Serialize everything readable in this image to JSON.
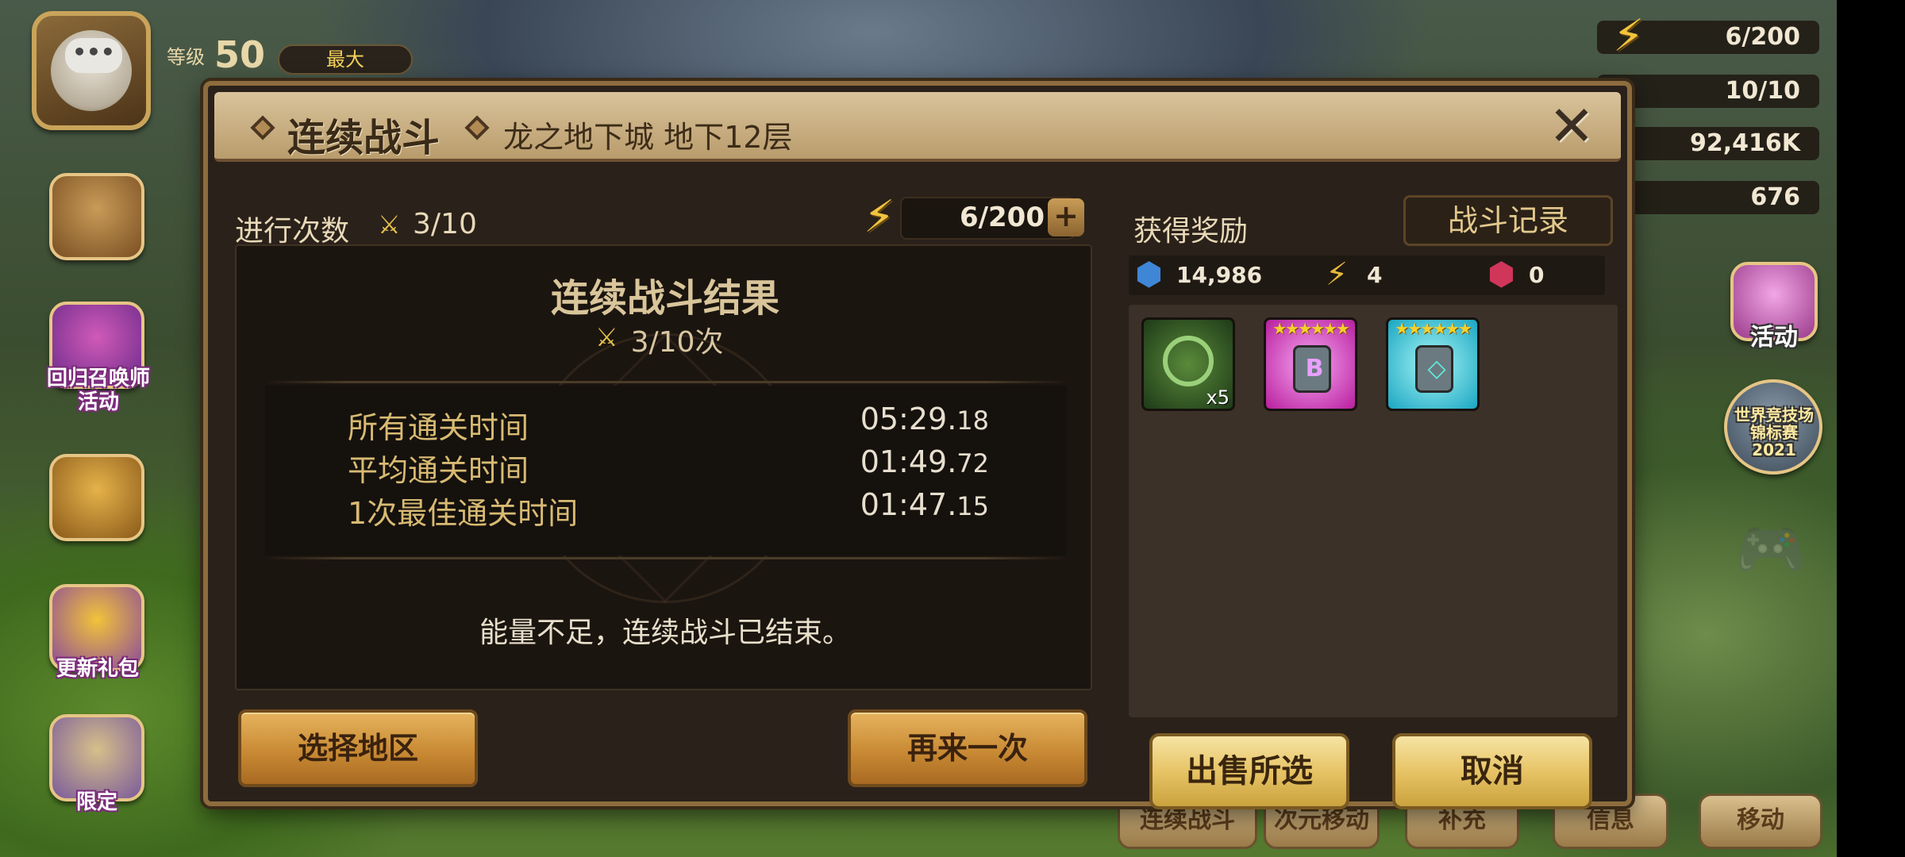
{
  "hud": {
    "chat_glyph": "•••",
    "level_label": "等级",
    "level_value": "50",
    "level_bar_text": "最大",
    "resources": [
      "6/200",
      "10/10",
      "92,416K",
      "676"
    ],
    "left_menu": [
      {
        "label": "",
        "icon": "tome-icon"
      },
      {
        "label": "回归召唤师\n活动",
        "icon": "gift-icon"
      },
      {
        "label": "",
        "icon": "treasure-chest-icon"
      },
      {
        "label": "更新礼包",
        "icon": "package-icon"
      },
      {
        "label": "限定",
        "icon": "limited-pack-icon"
      }
    ],
    "right_menu": [
      {
        "label": "活动",
        "icon": "event-icon"
      },
      {
        "label": "世界竞技场\n锦标赛\n2021",
        "icon": "trophy-icon"
      }
    ],
    "bottom_buttons": [
      "连续战斗",
      "次元移动",
      "补充",
      "信息",
      "移动"
    ]
  },
  "dialog": {
    "title": "连续战斗",
    "subtitle": "龙之地下城 地下12层",
    "close_glyph": "✕",
    "run_count_label": "进行次数",
    "run_count_value": "3/10",
    "energy_value": "6/200",
    "energy_plus": "+",
    "result": {
      "title": "连续战斗结果",
      "count": "3/10次",
      "times": [
        {
          "label": "所有通关时间",
          "main": "05:29.",
          "sub": "18"
        },
        {
          "label": "平均通关时间",
          "main": "01:49.",
          "sub": "72"
        },
        {
          "label": "1次最佳通关时间",
          "main": "01:47.",
          "sub": "15"
        }
      ],
      "status": "能量不足，连续战斗已结束。"
    },
    "select_area_button": "选择地区",
    "retry_button": "再来一次",
    "rewards": {
      "label": "获得奖励",
      "log_button": "战斗记录",
      "crystals": "14,986",
      "energy": "4",
      "rainbow": "0",
      "items": [
        {
          "icon": "wind-essence-icon",
          "qty": "x5",
          "stars": ""
        },
        {
          "icon": "rune-icon",
          "qty": "",
          "stars": "★★★★★★",
          "glyph": "B"
        },
        {
          "icon": "rune-icon",
          "qty": "",
          "stars": "★★★★★★",
          "glyph": "◇"
        }
      ]
    },
    "sell_button": "出售所选",
    "cancel_button": "取消"
  }
}
